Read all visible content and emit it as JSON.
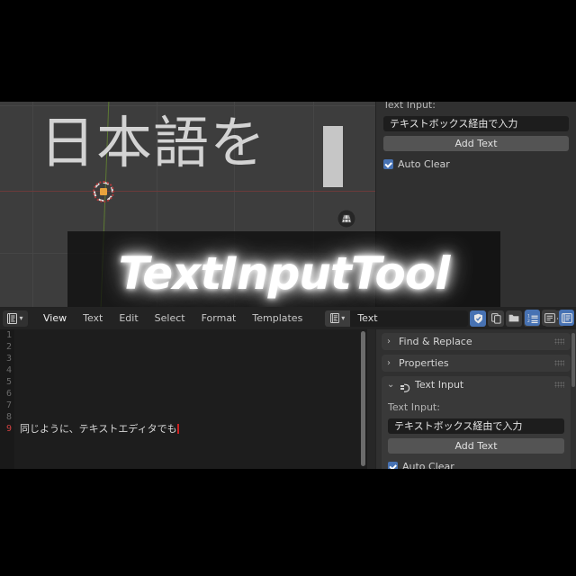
{
  "app": "Blender Text Input Tool",
  "title_overlay": {
    "text": "TextInputTool"
  },
  "viewport": {
    "object_text": "日本語を",
    "icons": {
      "cursor3d": "3d-cursor-icon",
      "snap": "snap-grid-icon"
    },
    "colors": {
      "background": "#3d3d3d",
      "x_axis": "#6b3b3b",
      "y_axis": "#5d7a33",
      "grid": "#464646"
    }
  },
  "upper_panel": {
    "label": "Text Input:",
    "field_value": "テキストボックス経由で入力",
    "add_button": "Add Text",
    "auto_clear": {
      "label": "Auto Clear",
      "checked": true
    }
  },
  "editor_header": {
    "editor_type_icon": "text-editor-icon",
    "menus": [
      "View",
      "Text",
      "Edit",
      "Select",
      "Format",
      "Templates"
    ],
    "active_menu": "View",
    "datablock": {
      "icon": "text-datablock-icon",
      "name": "Text",
      "buttons": [
        {
          "name": "fake-user-button",
          "icon": "shield-icon",
          "active": true
        },
        {
          "name": "new-text-button",
          "icon": "copy-icon",
          "active": false
        },
        {
          "name": "open-text-button",
          "icon": "folder-icon",
          "active": false
        },
        {
          "name": "unlink-text-button",
          "icon": "close-icon",
          "active": false
        },
        {
          "name": "run-script-button",
          "icon": "play-icon",
          "active": false
        }
      ]
    },
    "right_toggles": [
      {
        "name": "line-numbers-toggle",
        "icon": "line-numbers-icon",
        "active": true
      },
      {
        "name": "word-wrap-toggle",
        "icon": "word-wrap-icon",
        "active": false
      },
      {
        "name": "syntax-highlight-toggle",
        "icon": "syntax-icon",
        "active": true
      }
    ]
  },
  "editor_body": {
    "line_numbers": [
      "1",
      "2",
      "3",
      "4",
      "5",
      "6",
      "7",
      "8",
      "9"
    ],
    "current_line": 9,
    "lines": [
      "",
      "",
      "",
      "",
      "",
      "",
      "",
      "",
      "同じように、テキストエディタでも"
    ]
  },
  "sidebar": {
    "panels": [
      {
        "title": "Find & Replace",
        "expanded": false,
        "icon": "chevron-right-icon"
      },
      {
        "title": "Properties",
        "expanded": false,
        "icon": "chevron-right-icon"
      },
      {
        "title": "Text Input",
        "expanded": true,
        "icon": "chevron-down-icon",
        "badge_icon": "addon-plugin-icon"
      }
    ],
    "text_input": {
      "label": "Text Input:",
      "field_value": "テキストボックス経由で入力",
      "add_button": "Add Text",
      "auto_clear": {
        "label": "Auto Clear",
        "checked": true
      }
    }
  },
  "colors": {
    "panel_bg": "#303030",
    "panel_header": "#393939",
    "field_bg": "#1d1d1d",
    "button_bg": "#545454",
    "accent_blue": "#4772b3",
    "editor_bg": "#1d1d1d",
    "header_bg": "#232323",
    "current_line_num": "#d04040"
  }
}
